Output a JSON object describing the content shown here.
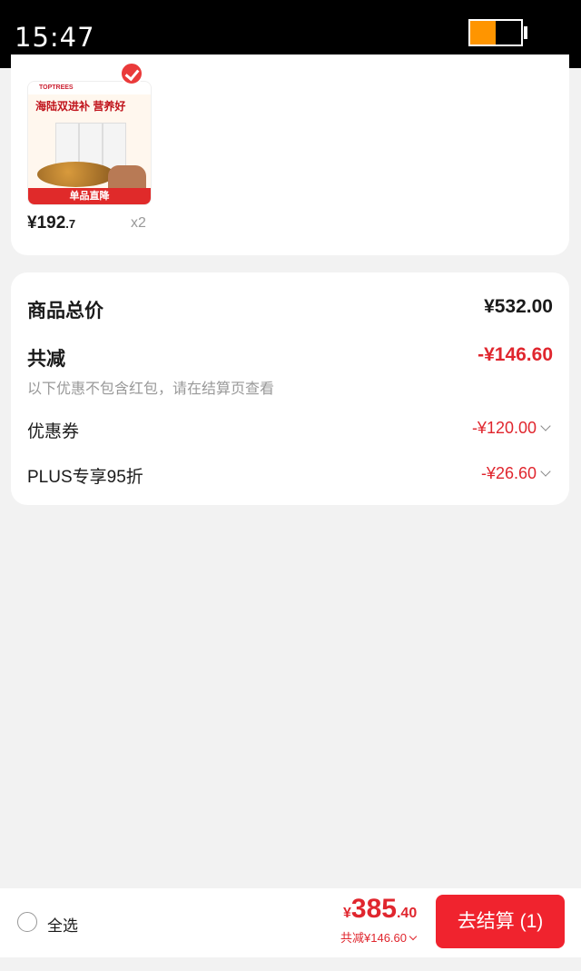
{
  "status_bar": {
    "time": "15:47",
    "battery_level": 0.5
  },
  "product": {
    "thumbnail": {
      "brand": "TOPTREES",
      "slogan": "海陆双进补 营养好",
      "banner": "单品直降"
    },
    "price_main": "¥192",
    "price_decimal": ".7",
    "quantity": "x2",
    "selected": true
  },
  "summary": {
    "total_label": "商品总价",
    "total_value": "¥532.00",
    "reduce_label": "共减",
    "reduce_value": "-¥146.60",
    "note": "以下优惠不包含红包，请在结算页查看",
    "coupon_label": "优惠券",
    "coupon_value": "-¥120.00",
    "plus_label": "PLUS专享95折",
    "plus_value": "-¥26.60"
  },
  "bottom": {
    "select_all_label": "全选",
    "currency": "¥",
    "amount_int": "385",
    "amount_dec": ".40",
    "saved_text": "共减¥146.60",
    "checkout_label": "去结算 (1)"
  },
  "colors": {
    "accent": "#e0262e",
    "checkout": "#f0232e",
    "battery": "#ff9500"
  }
}
